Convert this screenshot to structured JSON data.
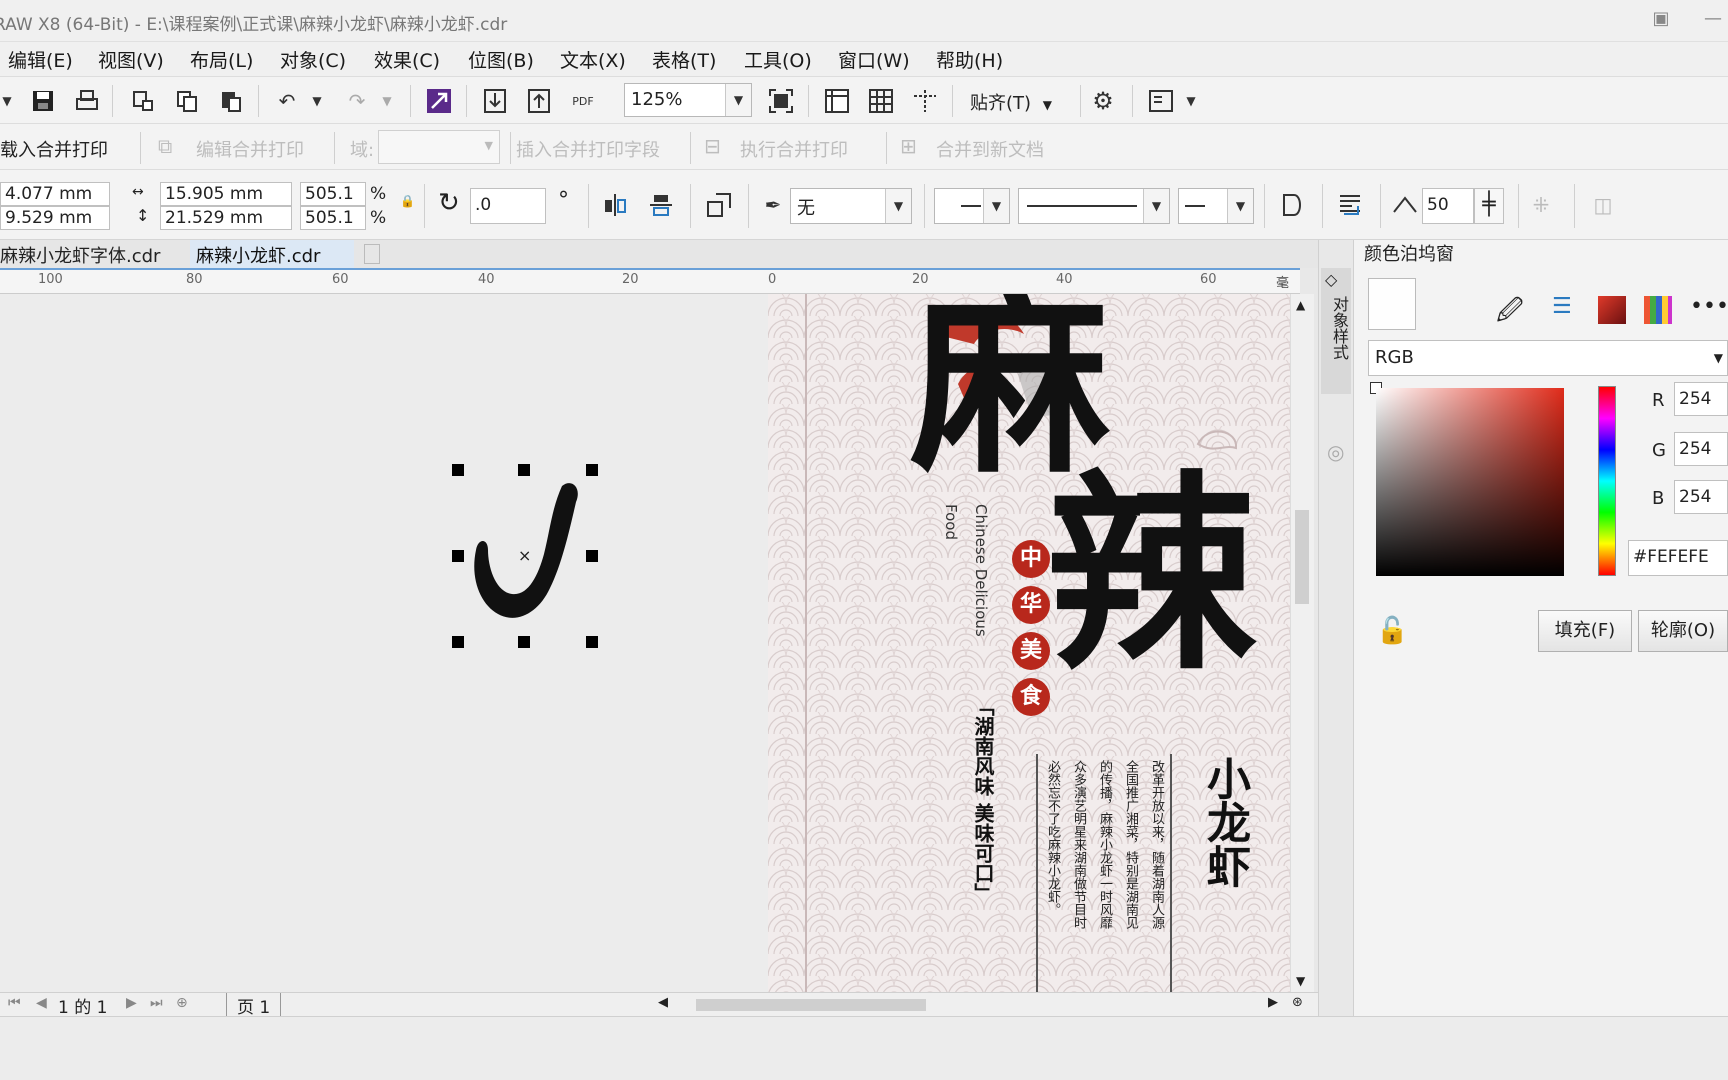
{
  "window": {
    "title": "RAW X8 (64-Bit) - E:\\课程案例\\正式课\\麻辣小龙虾\\麻辣小龙虾.cdr"
  },
  "menu": [
    "编辑(E)",
    "视图(V)",
    "布局(L)",
    "对象(C)",
    "效果(C)",
    "位图(B)",
    "文本(X)",
    "表格(T)",
    "工具(O)",
    "窗口(W)",
    "帮助(H)"
  ],
  "toolbar": {
    "pdf_label": "PDF",
    "zoom": "125%",
    "snap": "贴齐(T)"
  },
  "merge_toolbar": {
    "load": "载入合并打印",
    "edit": "编辑合并打印",
    "domain_label": "域:",
    "insert": "插入合并打印字段",
    "execute": "执行合并打印",
    "merge_new": "合并到新文档"
  },
  "properties": {
    "x": "4.077 mm",
    "y": "9.529 mm",
    "width": "15.905 mm",
    "height": "21.529 mm",
    "scale_w": "505.1",
    "scale_h": "505.1",
    "percent": "%",
    "rotation": ".0",
    "degree": "°",
    "outline_none": "无",
    "smooth_value": "50"
  },
  "tabs": [
    "麻辣小龙虾字体.cdr",
    "麻辣小龙虾.cdr"
  ],
  "ruler": {
    "ticks": [
      "100",
      "80",
      "60",
      "40",
      "20",
      "0",
      "20",
      "40",
      "60"
    ],
    "unit": "毫米"
  },
  "page_nav": {
    "text": "1 的 1",
    "page": "页 1"
  },
  "side_tab": "对象样式",
  "poster": {
    "title_char1": "麻",
    "title_char2": "辣",
    "sub": "小龙虾",
    "badges": [
      "中",
      "华",
      "美",
      "食"
    ],
    "eng1": "Chinese Delicious",
    "eng2": "Food",
    "vertical1": "「湖南风味  美味可口」",
    "body_cols": [
      "改革开放以来，随着湖南人源",
      "全国推广湘菜，特别是湖南见",
      "的传播，麻辣小龙虾一时风靡",
      "众多演艺明星来湖南做节目时",
      "必然忘不了吃麻辣小龙虾。"
    ]
  },
  "dock": {
    "title": "颜色泊坞窗",
    "model": "RGB",
    "r_label": "R",
    "r": "254",
    "g_label": "G",
    "g": "254",
    "b_label": "B",
    "b": "254",
    "hex": "#FEFEFE",
    "fill_btn": "填充(F)",
    "outline_btn": "轮廓(O)"
  },
  "colors": {
    "accent_blue": "#6aa0d8",
    "badge_red": "#b8281c",
    "current_color": "#FEFEFE"
  }
}
